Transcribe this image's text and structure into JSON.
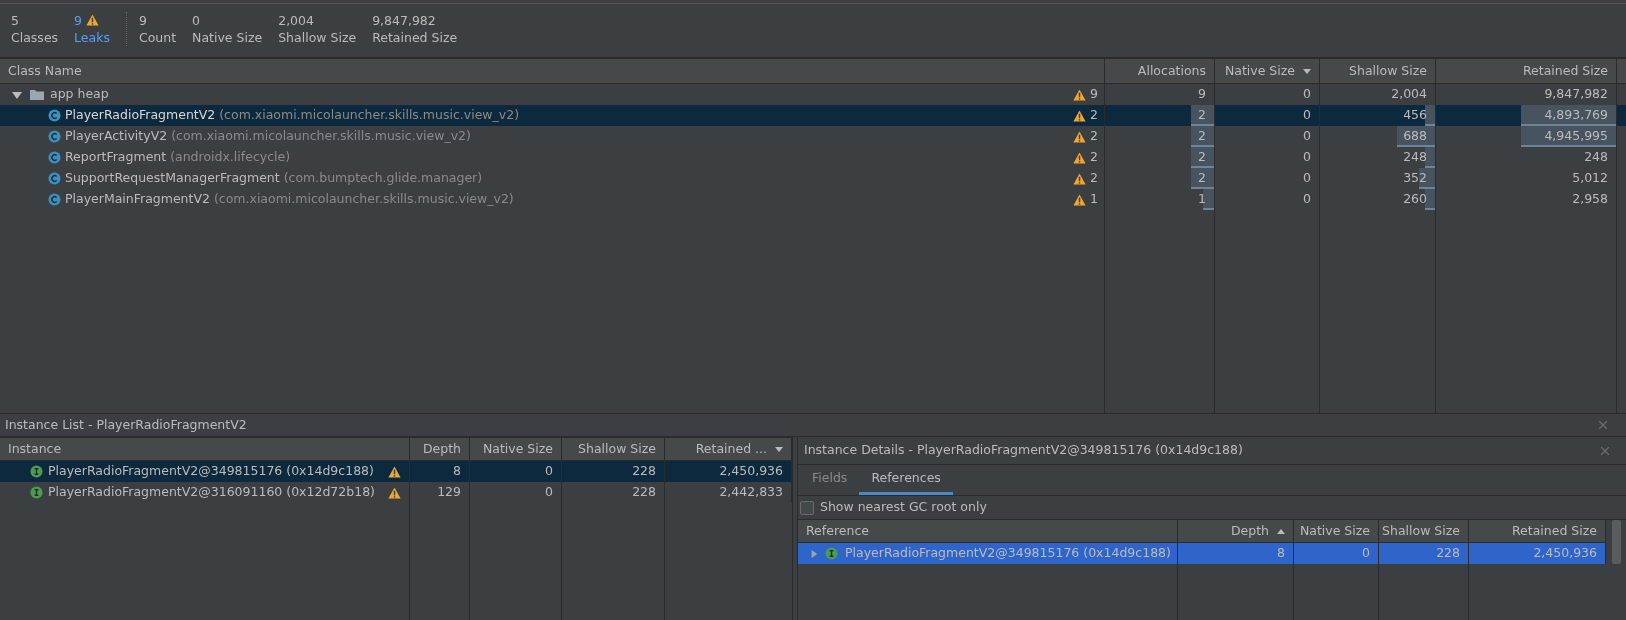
{
  "summary": [
    {
      "value": "5",
      "label": "Classes",
      "kind": "count"
    },
    {
      "value": "9",
      "label": "Leaks",
      "kind": "leak"
    },
    {
      "value": "9",
      "label": "Count",
      "kind": "count"
    },
    {
      "value": "0",
      "label": "Native Size",
      "kind": "count"
    },
    {
      "value": "2,004",
      "label": "Shallow Size",
      "kind": "count"
    },
    {
      "value": "9,847,982",
      "label": "Retained Size",
      "kind": "count"
    }
  ],
  "class_table": {
    "columns": [
      {
        "label": "Class Name",
        "sorted": false
      },
      {
        "label": "Allocations",
        "sorted": false
      },
      {
        "label": "Native Size",
        "sorted": true,
        "ascending": false
      },
      {
        "label": "Shallow Size",
        "sorted": false
      },
      {
        "label": "Retained Size",
        "sorted": false
      }
    ],
    "root": {
      "name": "app heap",
      "expanded": true,
      "leaks": "9",
      "allocations": "9",
      "native": "0",
      "shallow": "2,004",
      "retained": "9,847,982",
      "children": [
        {
          "name": "PlayerRadioFragmentV2",
          "package": "(com.xiaomi.micolauncher.skills.music.view_v2)",
          "selected": true,
          "leaks": "2",
          "allocations": {
            "text": "2",
            "level": 0.21
          },
          "native": "0",
          "shallow": {
            "text": "456",
            "level": 0.09
          },
          "retained": {
            "text": "4,893,769",
            "level": 0.53
          }
        },
        {
          "name": "PlayerActivityV2",
          "package": "(com.xiaomi.micolauncher.skills.music.view_v2)",
          "selected": false,
          "leaks": "2",
          "allocations": {
            "text": "2",
            "level": 0.21
          },
          "native": "0",
          "shallow": {
            "text": "688",
            "level": 0.33
          },
          "retained": {
            "text": "4,945,995",
            "level": 0.53
          }
        },
        {
          "name": "ReportFragment",
          "package": "(androidx.lifecycle)",
          "selected": false,
          "leaks": "2",
          "allocations": {
            "text": "2",
            "level": 0.21
          },
          "native": "0",
          "shallow": {
            "text": "248",
            "level": 0.09
          },
          "retained": {
            "text": "248"
          }
        },
        {
          "name": "SupportRequestManagerFragment",
          "package": "(com.bumptech.glide.manager)",
          "selected": false,
          "leaks": "2",
          "allocations": {
            "text": "2",
            "level": 0.21
          },
          "native": "0",
          "shallow": {
            "text": "352",
            "level": 0.14
          },
          "retained": {
            "text": "5,012"
          }
        },
        {
          "name": "PlayerMainFragmentV2",
          "package": "(com.xiaomi.micolauncher.skills.music.view_v2)",
          "selected": false,
          "leaks": "1",
          "allocations": {
            "text": "1",
            "level": 0.1
          },
          "native": "0",
          "shallow": {
            "text": "260",
            "level": 0.09
          },
          "retained": {
            "text": "2,958"
          }
        }
      ]
    }
  },
  "instance_list": {
    "title": "Instance List - PlayerRadioFragmentV2",
    "columns": [
      {
        "label": "Instance",
        "sorted": false
      },
      {
        "label": "Depth",
        "sorted": false
      },
      {
        "label": "Native Size",
        "sorted": false
      },
      {
        "label": "Shallow Size",
        "sorted": false
      },
      {
        "label": "Retained ...",
        "sorted": true,
        "ascending": false
      }
    ],
    "rows": [
      {
        "instance": "PlayerRadioFragmentV2@349815176 (0x14d9c188)",
        "leak": true,
        "selected": true,
        "depth": "8",
        "native": "0",
        "shallow": "228",
        "retained": "2,450,936"
      },
      {
        "instance": "PlayerRadioFragmentV2@316091160 (0x12d72b18)",
        "leak": true,
        "selected": false,
        "depth": "129",
        "native": "0",
        "shallow": "228",
        "retained": "2,442,833"
      }
    ]
  },
  "instance_details": {
    "title": "Instance Details - PlayerRadioFragmentV2@349815176 (0x14d9c188)",
    "tabs": [
      {
        "label": "Fields",
        "selected": false
      },
      {
        "label": "References",
        "selected": true
      }
    ],
    "nearest_gc_root": {
      "label": "Show nearest GC root only",
      "checked": false
    },
    "columns": [
      {
        "label": "Reference",
        "sorted": false
      },
      {
        "label": "Depth",
        "sorted": true,
        "ascending": true
      },
      {
        "label": "Native Size",
        "sorted": false
      },
      {
        "label": "Shallow Size",
        "sorted": false
      },
      {
        "label": "Retained Size",
        "sorted": false
      }
    ],
    "rows": [
      {
        "reference": "PlayerRadioFragmentV2@349815176 (0x14d9c188)",
        "expanded": false,
        "selected": true,
        "depth": "8",
        "native": "0",
        "shallow": "228",
        "retained": "2,450,936"
      }
    ]
  }
}
